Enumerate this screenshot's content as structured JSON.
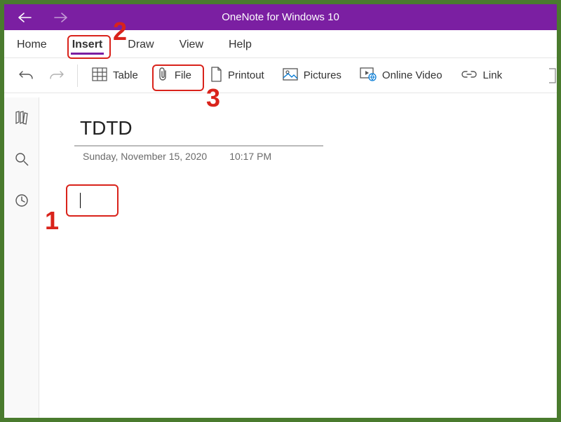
{
  "titlebar": {
    "appTitle": "OneNote for Windows 10"
  },
  "tabs": {
    "home": "Home",
    "insert": "Insert",
    "draw": "Draw",
    "view": "View",
    "help": "Help",
    "active": "insert"
  },
  "ribbon": {
    "table": "Table",
    "file": "File",
    "printout": "Printout",
    "pictures": "Pictures",
    "onlineVideo": "Online Video",
    "link": "Link"
  },
  "page": {
    "title": "TDTD",
    "date": "Sunday, November 15, 2020",
    "time": "10:17 PM"
  },
  "annotations": {
    "num1": "1",
    "num2": "2",
    "num3": "3"
  },
  "colors": {
    "accent": "#7b1fa2",
    "highlight": "#d9231b",
    "border": "#4a7b2e"
  }
}
